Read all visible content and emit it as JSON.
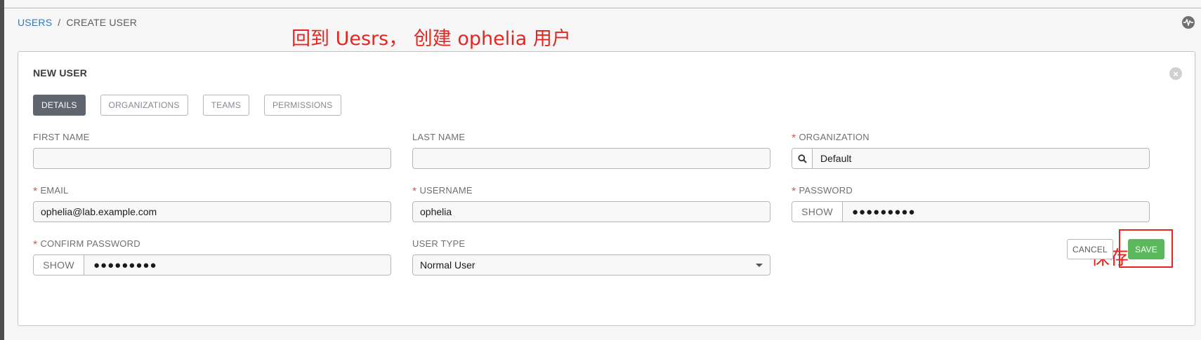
{
  "breadcrumb": {
    "parent": "USERS",
    "separator": "/",
    "current": "CREATE USER"
  },
  "annotations": {
    "top_note": "回到 Uesrs， 创建 ophelia 用户",
    "save_note": "保存"
  },
  "form": {
    "title": "NEW USER",
    "tabs": [
      {
        "label": "DETAILS",
        "active": true
      },
      {
        "label": "ORGANIZATIONS",
        "active": false
      },
      {
        "label": "TEAMS",
        "active": false
      },
      {
        "label": "PERMISSIONS",
        "active": false
      }
    ],
    "fields": {
      "first_name": {
        "label": "FIRST NAME",
        "value": ""
      },
      "last_name": {
        "label": "LAST NAME",
        "value": ""
      },
      "organization": {
        "label": "ORGANIZATION",
        "required_mark": "*",
        "value": "Default"
      },
      "email": {
        "label": "EMAIL",
        "required_mark": "*",
        "value": "ophelia@lab.example.com"
      },
      "username": {
        "label": "USERNAME",
        "required_mark": "*",
        "value": "ophelia"
      },
      "password": {
        "label": "PASSWORD",
        "required_mark": "*",
        "show_label": "SHOW",
        "masked": "●●●●●●●●●"
      },
      "confirm_password": {
        "label": "CONFIRM PASSWORD",
        "required_mark": "*",
        "show_label": "SHOW",
        "masked": "●●●●●●●●●"
      },
      "user_type": {
        "label": "USER TYPE",
        "value": "Normal User"
      }
    },
    "buttons": {
      "cancel": "CANCEL",
      "save": "SAVE"
    }
  },
  "icons": {
    "search": "search-icon",
    "close": "close-circle-icon",
    "activity": "activity-stream-icon",
    "dropdown": "caret-down-icon"
  },
  "colors": {
    "link": "#337ab7",
    "required": "#d9534f",
    "save": "#5cb85c",
    "active_tab": "#5f6670",
    "annotation": "#e52520"
  }
}
